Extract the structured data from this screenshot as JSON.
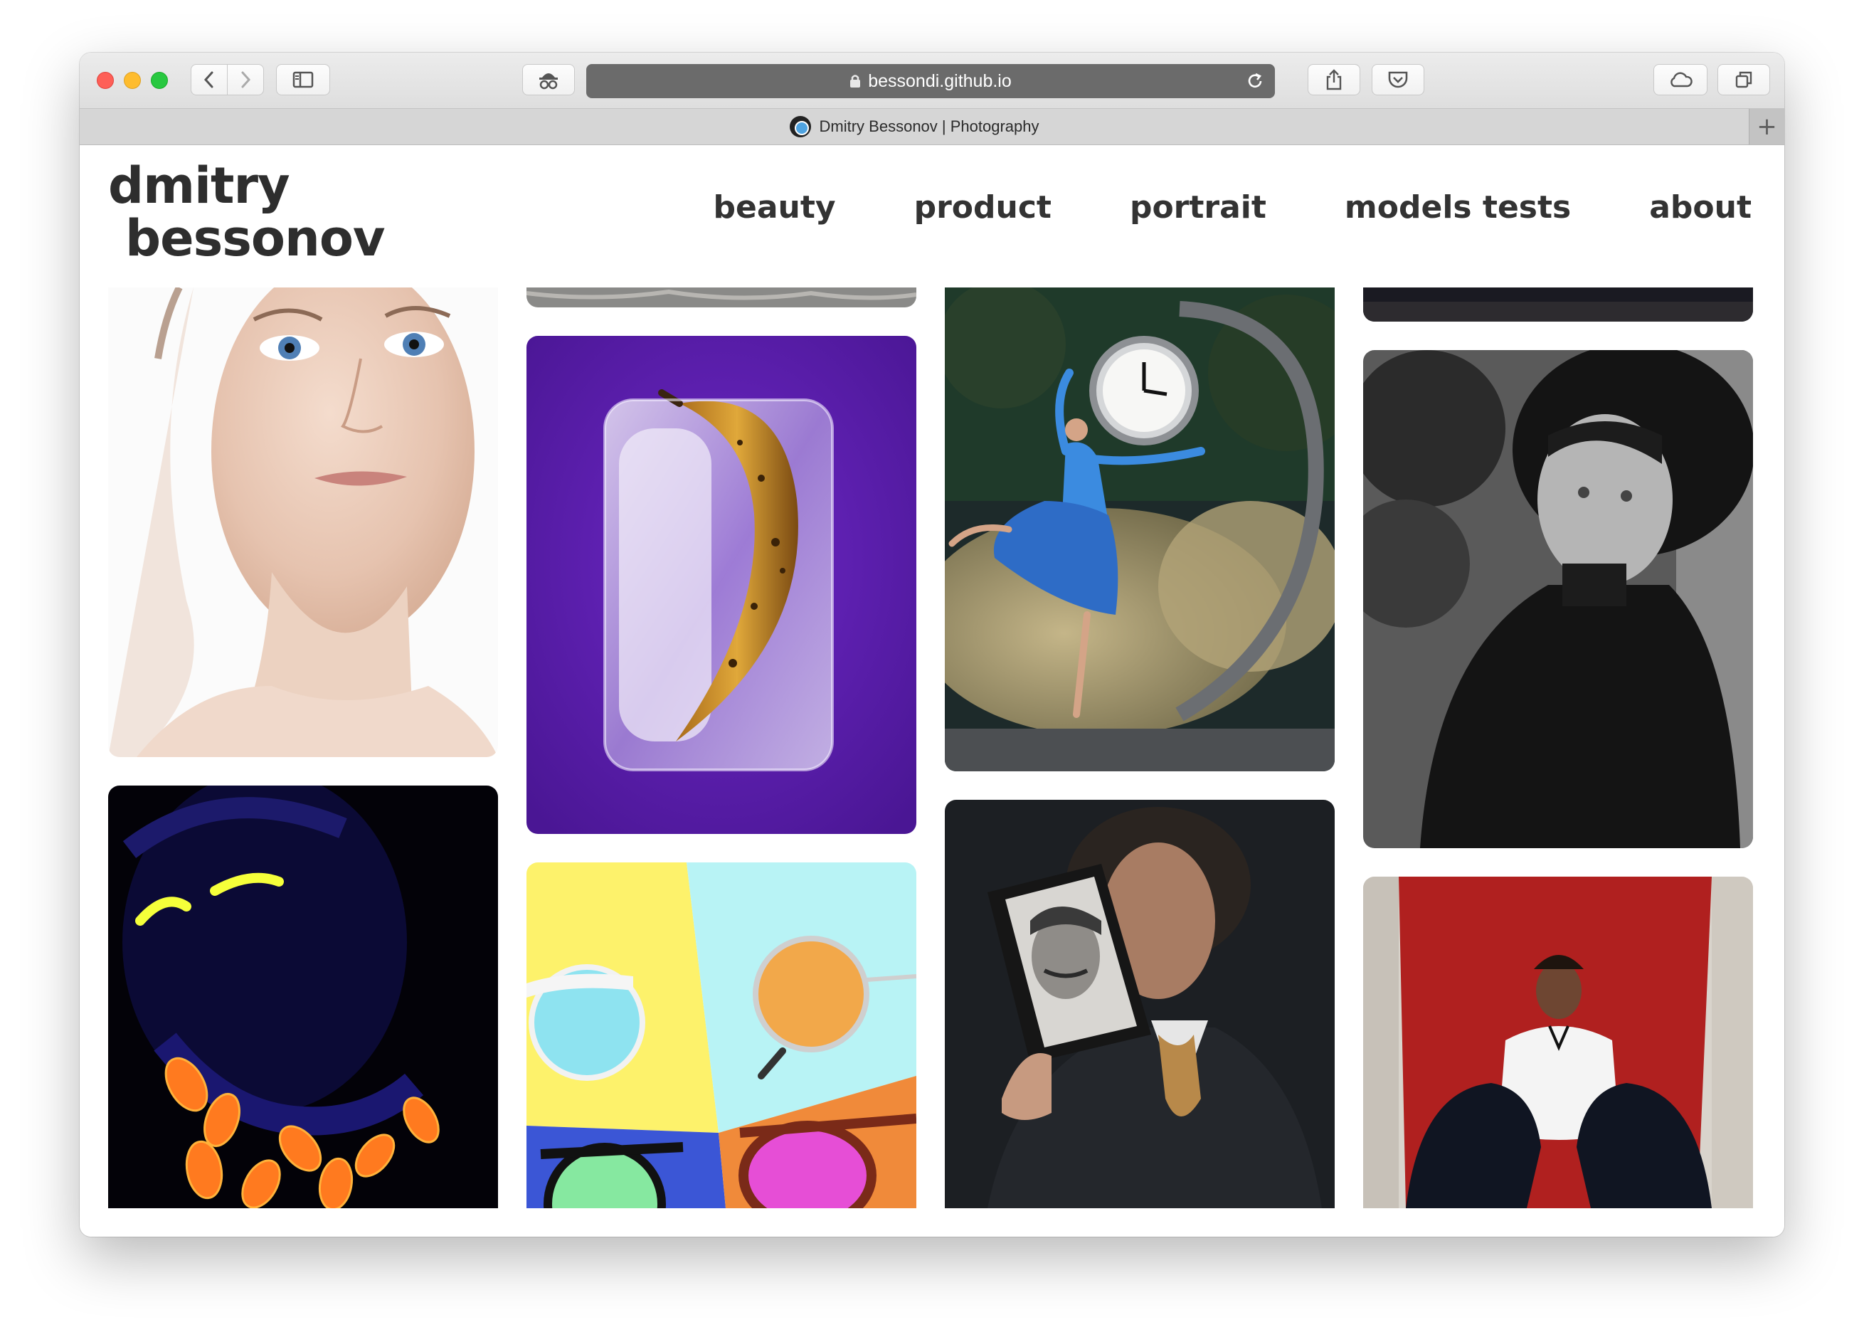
{
  "browser": {
    "url": "bessondi.github.io",
    "tab_title": "Dmitry Bessonov | Photography",
    "new_tab_symbol": "+"
  },
  "site": {
    "logo_line1": "dmitry",
    "logo_line2": "bessonov",
    "nav": [
      {
        "label": "beauty"
      },
      {
        "label": "product"
      },
      {
        "label": "portrait"
      },
      {
        "label": "models tests"
      },
      {
        "label": "about"
      }
    ]
  },
  "gallery": {
    "photos": [
      {
        "subject": "beauty-portrait-woman"
      },
      {
        "subject": "uv-neon-makeup"
      },
      {
        "subject": "frozen-banana-in-ice"
      },
      {
        "subject": "sunglasses-on-color-blocks"
      },
      {
        "subject": "ballerina-with-clock"
      },
      {
        "subject": "man-holding-book-portrait"
      },
      {
        "subject": "black-and-white-hat-portrait"
      },
      {
        "subject": "girl-on-red-door"
      }
    ]
  },
  "colors": {
    "nav_text": "#333333",
    "logo_text": "#2e2e2e",
    "url_bar": "#6b6b6b"
  }
}
